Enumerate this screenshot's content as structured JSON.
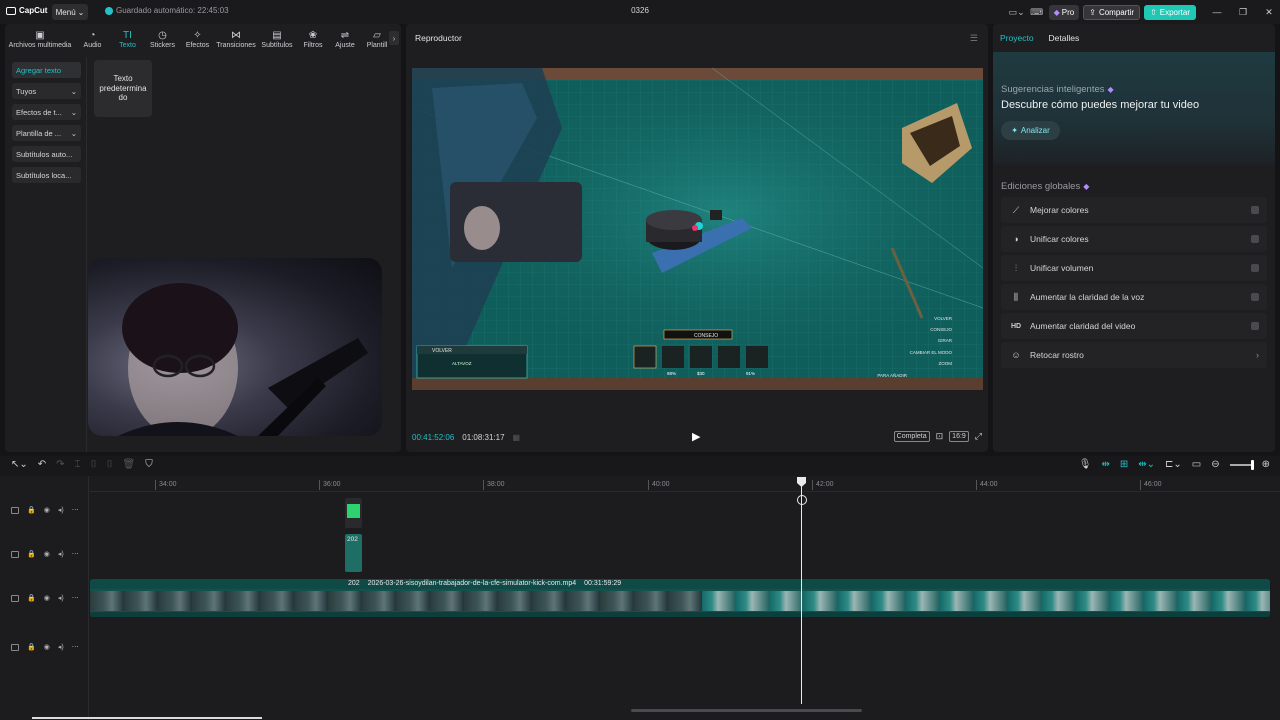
{
  "titlebar": {
    "app_logo": "CapCut",
    "menu_label": "Menú",
    "autosave": "Guardado automático: 22:45:03",
    "project_name": "0326",
    "pro_label": "Pro",
    "share_label": "Compartir",
    "export_label": "Exportar"
  },
  "media_tabs": [
    {
      "label": "Archivos multimedia",
      "icon": "media-icon"
    },
    {
      "label": "Audio",
      "icon": "audio-icon"
    },
    {
      "label": "Texto",
      "icon": "text-icon"
    },
    {
      "label": "Stickers",
      "icon": "sticker-icon"
    },
    {
      "label": "Efectos",
      "icon": "effects-icon"
    },
    {
      "label": "Transiciones",
      "icon": "transitions-icon"
    },
    {
      "label": "Subtítulos",
      "icon": "subtitles-icon"
    },
    {
      "label": "Filtros",
      "icon": "filters-icon"
    },
    {
      "label": "Ajuste",
      "icon": "adjust-icon"
    },
    {
      "label": "Plantill",
      "icon": "templates-icon"
    }
  ],
  "active_tab": "Texto",
  "text_menu": [
    {
      "label": "Agregar texto",
      "active": true,
      "dropdown": false
    },
    {
      "label": "Tuyos",
      "active": false,
      "dropdown": true
    },
    {
      "label": "Efectos de t...",
      "active": false,
      "dropdown": true
    },
    {
      "label": "Plantilla de ...",
      "active": false,
      "dropdown": true
    },
    {
      "label": "Subtítulos auto...",
      "active": false,
      "dropdown": false
    },
    {
      "label": "Subtítulos loca...",
      "active": false,
      "dropdown": false
    }
  ],
  "text_card": "Texto predetermina do",
  "player": {
    "title": "Reproductor",
    "current_time": "00:41:52:06",
    "total_time": "01:08:31:17",
    "quality_label": "Completa",
    "ratio_label": "16:9",
    "game_hud": {
      "back_label": "VOLVER",
      "speaker_label": "ALTAVOZ",
      "tip_label": "CONSEJO",
      "right_menu": [
        "VOLVER",
        "CONSEJO",
        "GIRAR",
        "CAMBIAR EL MODO",
        "ZOOM",
        "PARA AÑADIR"
      ],
      "slots": [
        "1",
        "2",
        "3",
        "4",
        "5"
      ],
      "stats": [
        "98%",
        "$30",
        "91%"
      ]
    }
  },
  "right_panel": {
    "tabs": [
      "Proyecto",
      "Detalles"
    ],
    "active_tab": "Proyecto",
    "suggestions_label": "Sugerencias inteligentes",
    "suggestions_title": "Descubre cómo puedes mejorar tu video",
    "analyze_label": "Analizar",
    "global_label": "Ediciones globales",
    "global_items": [
      {
        "label": "Mejorar colores",
        "icon": "enhance-colors-icon",
        "control": "toggle"
      },
      {
        "label": "Unificar colores",
        "icon": "unify-colors-icon",
        "control": "toggle"
      },
      {
        "label": "Unificar volumen",
        "icon": "unify-volume-icon",
        "control": "toggle"
      },
      {
        "label": "Aumentar la claridad de la voz",
        "icon": "voice-clarity-icon",
        "control": "toggle"
      },
      {
        "label": "Aumentar claridad del video",
        "icon": "hd-icon",
        "control": "toggle"
      },
      {
        "label": "Retocar rostro",
        "icon": "face-retouch-icon",
        "control": "chevron"
      }
    ]
  },
  "timeline": {
    "ruler_ticks": [
      "34:00",
      "36:00",
      "38:00",
      "40:00",
      "42:00",
      "44:00",
      "46:00"
    ],
    "small_clip_label": "202",
    "main_clip": {
      "prefix": "202",
      "filename": "2026-03-26-sisoydilan-trabajador-de-la-cfe-simulator-kick-com.mp4",
      "duration": "00:31:59:29"
    }
  },
  "colors": {
    "accent": "#22c2c7",
    "export": "#1ec8b5",
    "clip": "#11524d",
    "background": "#141416"
  }
}
